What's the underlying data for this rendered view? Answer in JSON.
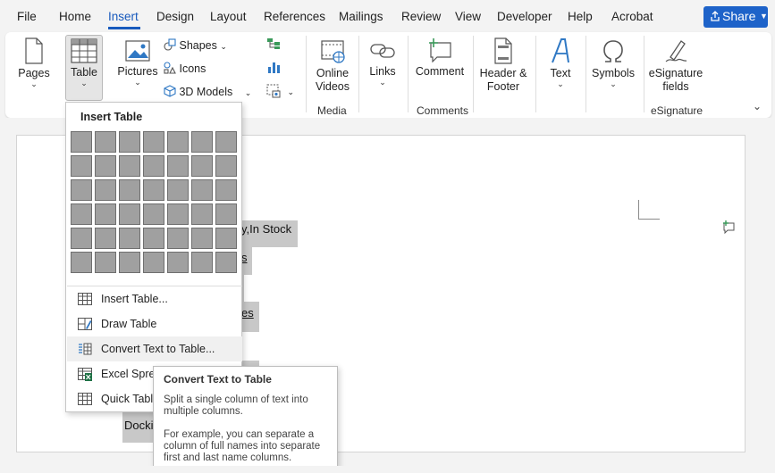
{
  "menu": {
    "items": [
      "File",
      "Home",
      "Insert",
      "Design",
      "Layout",
      "References",
      "Mailings",
      "Review",
      "View",
      "Developer",
      "Help",
      "Acrobat"
    ],
    "active": "Insert",
    "share_label": "Share"
  },
  "ribbon": {
    "pages": "Pages",
    "table": "Table",
    "pictures": "Pictures",
    "shapes": "Shapes",
    "icons": "Icons",
    "models3d": "3D Models",
    "online_videos": "Online Videos",
    "links": "Links",
    "comment": "Comment",
    "header_footer": "Header & Footer",
    "text": "Text",
    "symbols": "Symbols",
    "esignature_fields": "eSignature fields",
    "groups": {
      "media": "Media",
      "comments": "Comments",
      "esignature": "eSignature"
    }
  },
  "insert_table_menu": {
    "title": "Insert Table",
    "grid_rows": 6,
    "grid_cols": 7,
    "items": [
      {
        "label": "Insert Table...",
        "icon": "table-icon"
      },
      {
        "label": "Draw Table",
        "icon": "draw-table-icon"
      },
      {
        "label": "Convert Text to Table...",
        "icon": "convert-text-icon"
      },
      {
        "label": "Excel Spreadsheet",
        "icon": "excel-icon"
      },
      {
        "label": "Quick Tables",
        "icon": "quick-tables-icon"
      }
    ]
  },
  "tooltip": {
    "title": "Convert Text to Table",
    "body1": "Split a single column of text into multiple columns.",
    "body2": "For example, you can separate a column of full names into separate first and last name columns."
  },
  "document": {
    "visible_fragments": [
      "y,In Stock",
      "s",
      "es",
      "Docki"
    ]
  },
  "colors": {
    "accent": "#185abd",
    "share_bg": "#1e63c9",
    "highlight": "#c8c8c8"
  }
}
